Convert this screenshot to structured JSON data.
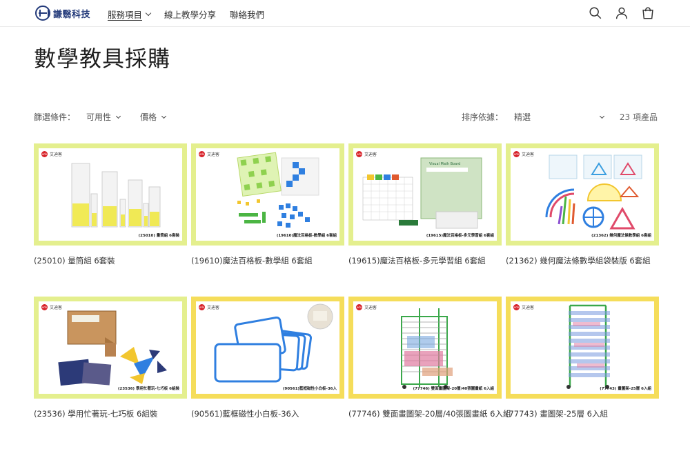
{
  "header": {
    "logo_text": "謙翳科技",
    "nav": [
      {
        "label": "服務項目",
        "dropdown": true,
        "active": true
      },
      {
        "label": "線上教學分享",
        "dropdown": false,
        "active": false
      },
      {
        "label": "聯絡我們",
        "dropdown": false,
        "active": false
      }
    ],
    "icons": [
      "search-icon",
      "account-icon",
      "cart-icon"
    ]
  },
  "page_title": "數學教具採購",
  "filters": {
    "label": "篩選條件：",
    "availability": "可用性",
    "price": "價格",
    "sort_label": "排序依據：",
    "sort_value": "精選",
    "count": "23 項產品"
  },
  "brand_name": "艾迪客",
  "brand_logo": "edx",
  "colors": {
    "frame_green": "#e4ef8e",
    "frame_yellow": "#f5dd5a",
    "brand_red": "#d8232a"
  },
  "products": [
    {
      "title": "(25010) 量筒組 6套裝",
      "tag": "(25010) 量筒組 6套裝"
    },
    {
      "title": "(19610)魔法百格板-數學組 6套組",
      "tag": "(19610)魔法百格板-數學組 6套組"
    },
    {
      "title": "(19615)魔法百格板-多元學習組 6套組",
      "tag": "(19615)魔法百格板-多元學習組 6套組"
    },
    {
      "title": "(21362) 幾何魔法條數學組袋裝版 6套組",
      "tag": "(21362) 幾何魔法條數學組 6套組"
    },
    {
      "title": "(23536) 學用忙著玩-七巧板 6組裝",
      "tag": "(23536) 學用忙著玩-七巧板 6組裝"
    },
    {
      "title": "(90561)藍框磁性小白板-36入",
      "tag": "(90561)藍框磁性小白板-36入"
    },
    {
      "title": "(77746) 雙面畫圖架-20層/40張圖畫紙 6入組",
      "tag": "(77746) 雙面畫圖架-20層/40張圖畫紙 6入組"
    },
    {
      "title": "(77743) 畫圖架-25層 6入組",
      "tag": "(77743) 畫圖架-25層 6入組"
    }
  ],
  "board_box_title": "Visual Math Board"
}
